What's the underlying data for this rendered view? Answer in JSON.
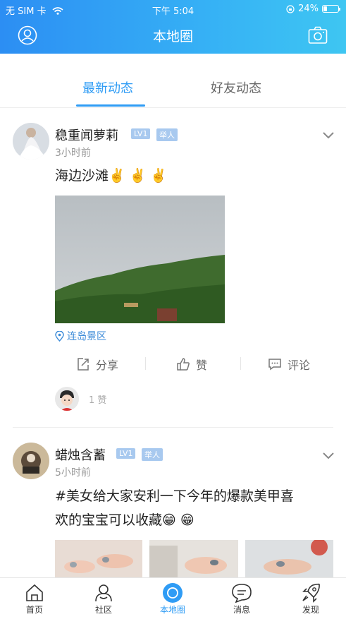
{
  "status_bar": {
    "carrier": "无 SIM 卡",
    "time": "下午 5:04",
    "battery": "24%"
  },
  "header": {
    "title": "本地圈"
  },
  "tabs": [
    {
      "label": "最新动态",
      "active": true
    },
    {
      "label": "好友动态",
      "active": false
    }
  ],
  "posts": [
    {
      "user": "稳重闻萝莉",
      "level": "LV1",
      "report": "举人",
      "time": "3小时前",
      "text": "海边沙滩✌️ ✌️ ✌️",
      "location": "连岛景区",
      "actions": {
        "share": "分享",
        "like": "赞",
        "comment": "评论"
      },
      "likes": "1 赞"
    },
    {
      "user": "蜡烛含蓄",
      "level": "LV1",
      "report": "举人",
      "time": "5小时前",
      "text_line1": "#美女给大家安利一下今年的爆款美甲喜",
      "text_line2": "欢的宝宝可以收藏😁 😁"
    }
  ],
  "tabbar": [
    {
      "label": "首页",
      "icon": "home-icon"
    },
    {
      "label": "社区",
      "icon": "community-icon"
    },
    {
      "label": "本地圈",
      "icon": "local-circle-icon",
      "active": true
    },
    {
      "label": "消息",
      "icon": "message-icon"
    },
    {
      "label": "发现",
      "icon": "rocket-icon"
    }
  ],
  "colors": {
    "accent": "#2f9cf5",
    "header_start": "#2c8ef3",
    "header_end": "#3ec6f2",
    "badge": "#a8c9ef"
  }
}
